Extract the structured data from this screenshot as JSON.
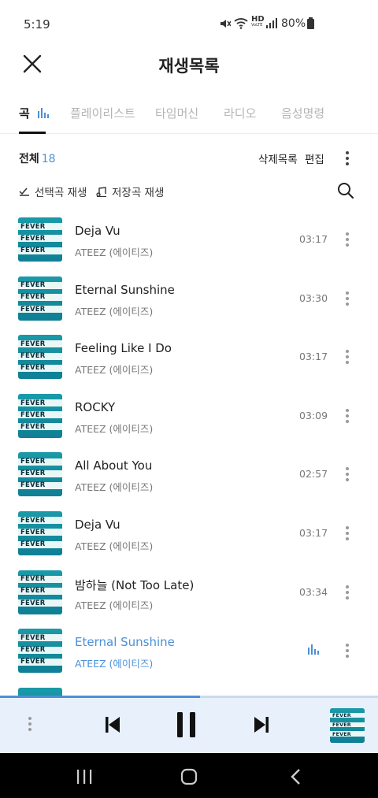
{
  "status_bar": {
    "time": "5:19",
    "network_label": "HD",
    "network_sub": "VoLTE",
    "battery": "80%"
  },
  "header": {
    "title": "재생목록",
    "close_icon": "close-icon"
  },
  "tabs": [
    {
      "label": "곡",
      "active": true
    },
    {
      "label": "플레이리스트",
      "active": false
    },
    {
      "label": "타임머신",
      "active": false
    },
    {
      "label": "라디오",
      "active": false
    },
    {
      "label": "음성명령",
      "active": false
    }
  ],
  "list_header": {
    "count_label": "전체",
    "count": "18",
    "delete_list": "삭제목록",
    "edit": "편집"
  },
  "actions": {
    "play_selected": "선택곡 재생",
    "play_saved": "저장곡 재생"
  },
  "album_art_text": [
    "FEVER",
    "FEVER",
    "FEVER"
  ],
  "songs": [
    {
      "title": "Deja Vu",
      "artist": "ATEEZ (에이티즈)",
      "duration": "03:17"
    },
    {
      "title": "Eternal Sunshine",
      "artist": "ATEEZ (에이티즈)",
      "duration": "03:30"
    },
    {
      "title": "Feeling Like I Do",
      "artist": "ATEEZ (에이티즈)",
      "duration": "03:17"
    },
    {
      "title": "ROCKY",
      "artist": "ATEEZ (에이티즈)",
      "duration": "03:09"
    },
    {
      "title": "All About You",
      "artist": "ATEEZ (에이티즈)",
      "duration": "02:57"
    },
    {
      "title": "Deja Vu",
      "artist": "ATEEZ (에이티즈)",
      "duration": "03:17"
    },
    {
      "title": "밤하늘 (Not Too Late)",
      "artist": "ATEEZ (에이티즈)",
      "duration": "03:34"
    },
    {
      "title": "Eternal Sunshine",
      "artist": "ATEEZ (에이티즈)",
      "duration": "",
      "now_playing": true
    }
  ],
  "player": {
    "progress_fraction": 0.53,
    "accent_color": "#4a90d9"
  },
  "colors": {
    "accent": "#4a90d9",
    "player_bg": "#e8f1fb",
    "album_teal": "#1a9aa8"
  }
}
